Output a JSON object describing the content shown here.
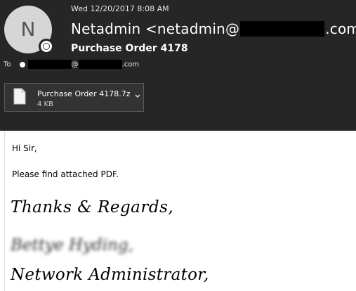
{
  "header": {
    "avatar_initial": "N",
    "date": "Wed 12/20/2017 8:08 AM",
    "from_prefix": "Netadmin <netadmin@",
    "from_suffix": ".com>",
    "subject": "Purchase Order 4178",
    "to_label": "To",
    "to_at": "@",
    "to_suffix": ".com"
  },
  "attachment": {
    "name": "Purchase Order 4178.7z",
    "size": "4 KB",
    "icon": "file-icon"
  },
  "body": {
    "greeting": "Hi Sir,",
    "line1": "Please find attached PDF.",
    "sig_line1": "Thanks & Regards,",
    "sig_line2_blurred": "Bettye Hyding,",
    "sig_line3": "Network Administrator,"
  },
  "colors": {
    "header_bg": "#262626",
    "redaction": "#000000",
    "body_bg": "#ffffff"
  }
}
